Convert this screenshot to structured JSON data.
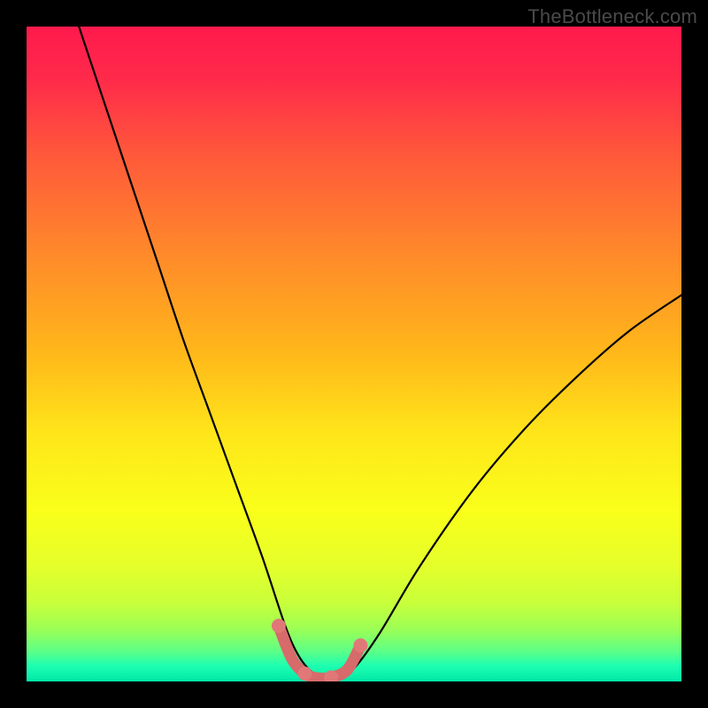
{
  "watermark": "TheBottleneck.com",
  "colors": {
    "black": "#000000",
    "curve": "#000000",
    "annotation": "#d76a6a",
    "annotation_dot_fill": "#e17878",
    "gradient_stops": [
      {
        "offset": 0.0,
        "color": "#ff1a4d"
      },
      {
        "offset": 0.08,
        "color": "#ff2a4a"
      },
      {
        "offset": 0.2,
        "color": "#ff5a3a"
      },
      {
        "offset": 0.35,
        "color": "#ff8a2a"
      },
      {
        "offset": 0.5,
        "color": "#ffb81a"
      },
      {
        "offset": 0.62,
        "color": "#ffe51a"
      },
      {
        "offset": 0.74,
        "color": "#f9ff1a"
      },
      {
        "offset": 0.82,
        "color": "#e6ff2a"
      },
      {
        "offset": 0.88,
        "color": "#c8ff3a"
      },
      {
        "offset": 0.92,
        "color": "#9cff55"
      },
      {
        "offset": 0.955,
        "color": "#5aff88"
      },
      {
        "offset": 0.975,
        "color": "#20ffb0"
      },
      {
        "offset": 1.0,
        "color": "#00e8a8"
      }
    ]
  },
  "chart_data": {
    "type": "line",
    "title": "",
    "xlabel": "",
    "ylabel": "",
    "xlim": [
      0,
      1
    ],
    "ylim": [
      0,
      1
    ],
    "series": [
      {
        "name": "bottleneck-curve",
        "x": [
          0.08,
          0.12,
          0.16,
          0.2,
          0.24,
          0.28,
          0.32,
          0.36,
          0.395,
          0.415,
          0.435,
          0.455,
          0.475,
          0.5,
          0.54,
          0.6,
          0.68,
          0.76,
          0.84,
          0.92,
          1.0
        ],
        "y": [
          1.0,
          0.88,
          0.76,
          0.64,
          0.52,
          0.41,
          0.3,
          0.19,
          0.085,
          0.04,
          0.015,
          0.005,
          0.005,
          0.02,
          0.075,
          0.175,
          0.29,
          0.385,
          0.465,
          0.535,
          0.59
        ]
      }
    ],
    "annotation": {
      "name": "flat-region-highlight",
      "x": [
        0.385,
        0.405,
        0.425,
        0.445,
        0.465,
        0.49,
        0.51
      ],
      "y": [
        0.085,
        0.035,
        0.012,
        0.005,
        0.006,
        0.018,
        0.055
      ]
    }
  }
}
